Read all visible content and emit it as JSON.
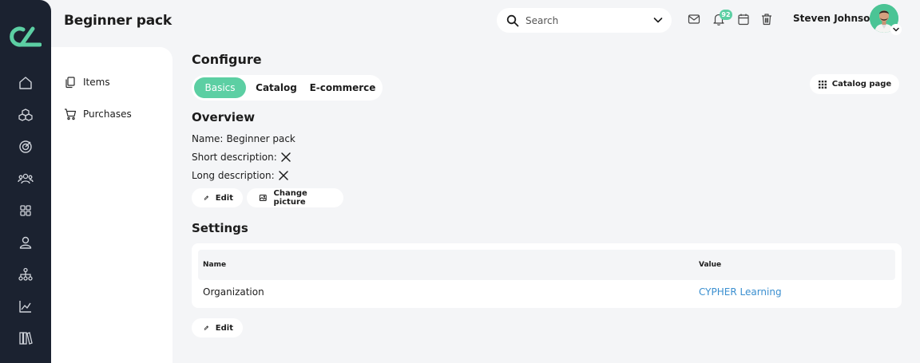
{
  "page": {
    "title": "Beginner pack"
  },
  "rail": {
    "icons": [
      "home-icon",
      "cubes-icon",
      "target-icon",
      "users-icon",
      "grid-icon",
      "user-icon",
      "hierarchy-icon",
      "chart-icon",
      "library-icon"
    ]
  },
  "subnav": {
    "items": [
      {
        "label": "Items",
        "icon": "pages-icon"
      },
      {
        "label": "Purchases",
        "icon": "cart-icon"
      }
    ]
  },
  "header": {
    "search_placeholder": "Search",
    "notification_count": "92",
    "user_name": "Steven Johnson"
  },
  "configure": {
    "heading": "Configure",
    "tabs": [
      {
        "label": "Basics",
        "active": true
      },
      {
        "label": "Catalog",
        "active": false
      },
      {
        "label": "E-commerce",
        "active": false
      }
    ],
    "catalog_page_label": "Catalog page"
  },
  "overview": {
    "heading": "Overview",
    "name_label": "Name:",
    "name_value": "Beginner pack",
    "short_desc_label": "Short description:",
    "long_desc_label": "Long description:",
    "edit_label": "Edit",
    "change_picture_label": "Change picture"
  },
  "settings": {
    "heading": "Settings",
    "columns": [
      "Name",
      "Value"
    ],
    "rows": [
      {
        "name": "Organization",
        "value": "CYPHER Learning"
      }
    ],
    "edit_label": "Edit"
  },
  "colors": {
    "accent": "#5ccfa3",
    "rail": "#1b2230",
    "link": "#3a8fd0",
    "background": "#f4f5f7"
  }
}
